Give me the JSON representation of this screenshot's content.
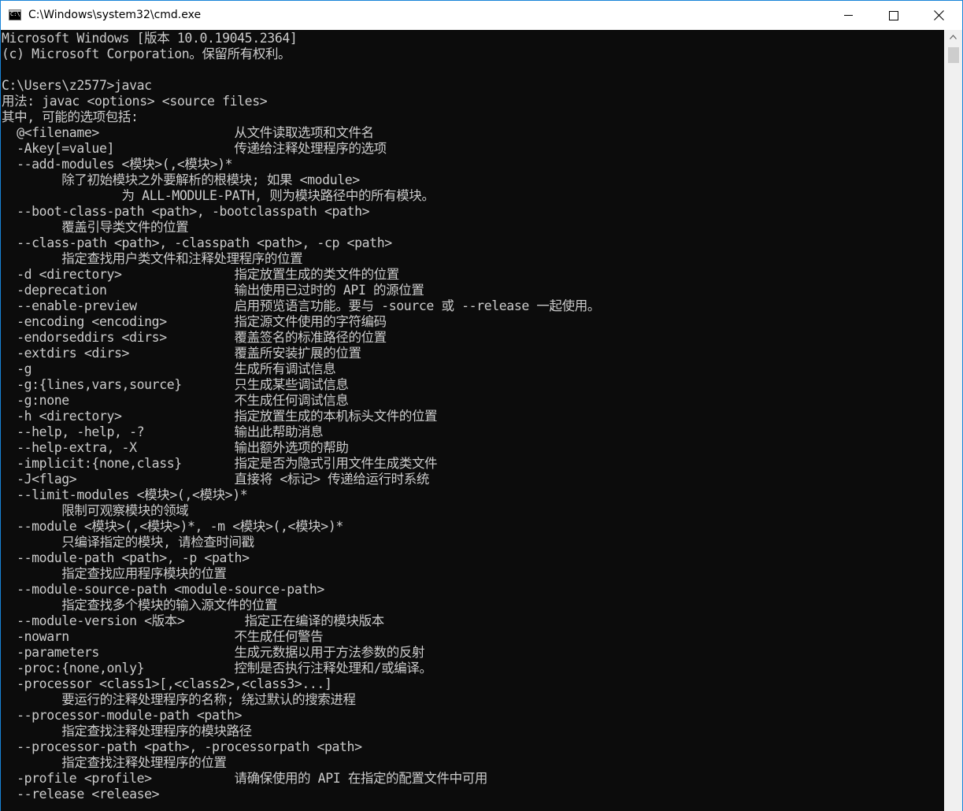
{
  "window": {
    "title": "C:\\Windows\\system32\\cmd.exe",
    "icon": "cmd-icon",
    "icon_glyph": "C:\\"
  },
  "controls": {
    "minimize": "minimize-icon",
    "maximize": "maximize-icon",
    "close": "close-icon"
  },
  "colors": {
    "console_bg": "#0c0c0c",
    "console_fg": "#cccccc",
    "window_border": "#1883d7"
  },
  "console": {
    "lines": [
      "Microsoft Windows [版本 10.0.19045.2364]",
      "(c) Microsoft Corporation。保留所有权利。",
      "",
      "C:\\Users\\z2577>javac",
      "用法: javac <options> <source files>",
      "其中, 可能的选项包括:",
      "  @<filename>                  从文件读取选项和文件名",
      "  -Akey[=value]                传递给注释处理程序的选项",
      "  --add-modules <模块>(,<模块>)*",
      "        除了初始模块之外要解析的根模块; 如果 <module>",
      "                为 ALL-MODULE-PATH, 则为模块路径中的所有模块。",
      "  --boot-class-path <path>, -bootclasspath <path>",
      "        覆盖引导类文件的位置",
      "  --class-path <path>, -classpath <path>, -cp <path>",
      "        指定查找用户类文件和注释处理程序的位置",
      "  -d <directory>               指定放置生成的类文件的位置",
      "  -deprecation                 输出使用已过时的 API 的源位置",
      "  --enable-preview             启用预览语言功能。要与 -source 或 --release 一起使用。",
      "  -encoding <encoding>         指定源文件使用的字符编码",
      "  -endorseddirs <dirs>         覆盖签名的标准路径的位置",
      "  -extdirs <dirs>              覆盖所安装扩展的位置",
      "  -g                           生成所有调试信息",
      "  -g:{lines,vars,source}       只生成某些调试信息",
      "  -g:none                      不生成任何调试信息",
      "  -h <directory>               指定放置生成的本机标头文件的位置",
      "  --help, -help, -?            输出此帮助消息",
      "  --help-extra, -X             输出额外选项的帮助",
      "  -implicit:{none,class}       指定是否为隐式引用文件生成类文件",
      "  -J<flag>                     直接将 <标记> 传递给运行时系统",
      "  --limit-modules <模块>(,<模块>)*",
      "        限制可观察模块的领域",
      "  --module <模块>(,<模块>)*, -m <模块>(,<模块>)*",
      "        只编译指定的模块, 请检查时间戳",
      "  --module-path <path>, -p <path>",
      "        指定查找应用程序模块的位置",
      "  --module-source-path <module-source-path>",
      "        指定查找多个模块的输入源文件的位置",
      "  --module-version <版本>        指定正在编译的模块版本",
      "  -nowarn                      不生成任何警告",
      "  -parameters                  生成元数据以用于方法参数的反射",
      "  -proc:{none,only}            控制是否执行注释处理和/或编译。",
      "  -processor <class1>[,<class2>,<class3>...]",
      "        要运行的注释处理程序的名称; 绕过默认的搜索进程",
      "  --processor-module-path <path>",
      "        指定查找注释处理程序的模块路径",
      "  --processor-path <path>, -processorpath <path>",
      "        指定查找注释处理程序的位置",
      "  -profile <profile>           请确保使用的 API 在指定的配置文件中可用",
      "  --release <release>"
    ]
  }
}
